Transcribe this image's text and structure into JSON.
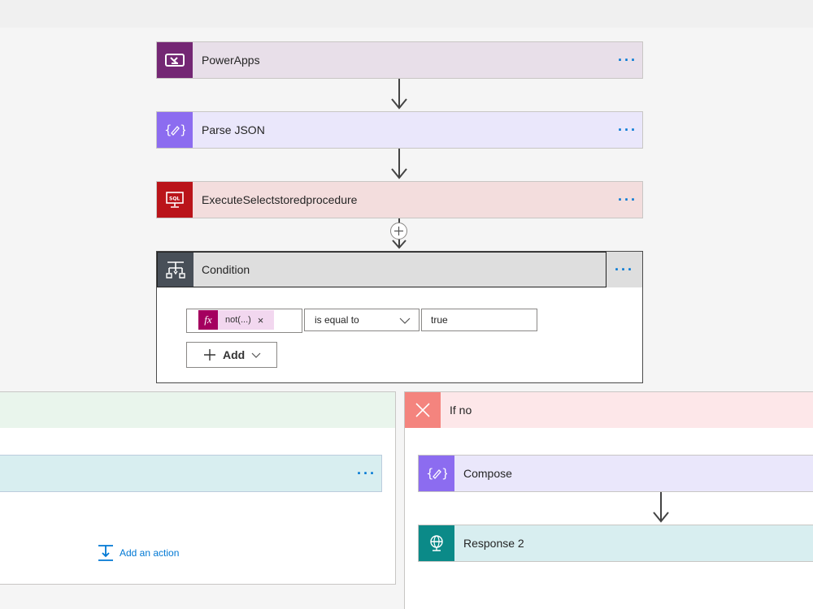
{
  "steps": [
    {
      "label": "PowerApps",
      "icon": "powerapps-icon",
      "color": "#742774",
      "bg": "#e8dfe9"
    },
    {
      "label": "Parse JSON",
      "icon": "braces-edit-icon",
      "color": "#8c6cf0",
      "bg": "#eae7fb"
    },
    {
      "label": "ExecuteSelectstoredprocedure",
      "icon": "sql-server-icon",
      "color": "#ba141a",
      "bg": "#f3dddd"
    }
  ],
  "condition": {
    "title": "Condition",
    "operand_token": "not(...)",
    "operand_remove": "×",
    "operator": "is equal to",
    "value": "true",
    "add_label": "Add"
  },
  "more_label": "···",
  "branch_no": {
    "title": "If no",
    "actions": [
      {
        "label": "Compose"
      },
      {
        "label": "Response 2"
      }
    ]
  },
  "branch_yes": {
    "add_action_label": "Add an action"
  },
  "colors": {
    "accent": "#0078d4",
    "compose": "#8c6cf0",
    "response": "#0b8a88",
    "no_branch_icon": "#f4847e",
    "yes_branch_head": "#e9f5ec"
  }
}
